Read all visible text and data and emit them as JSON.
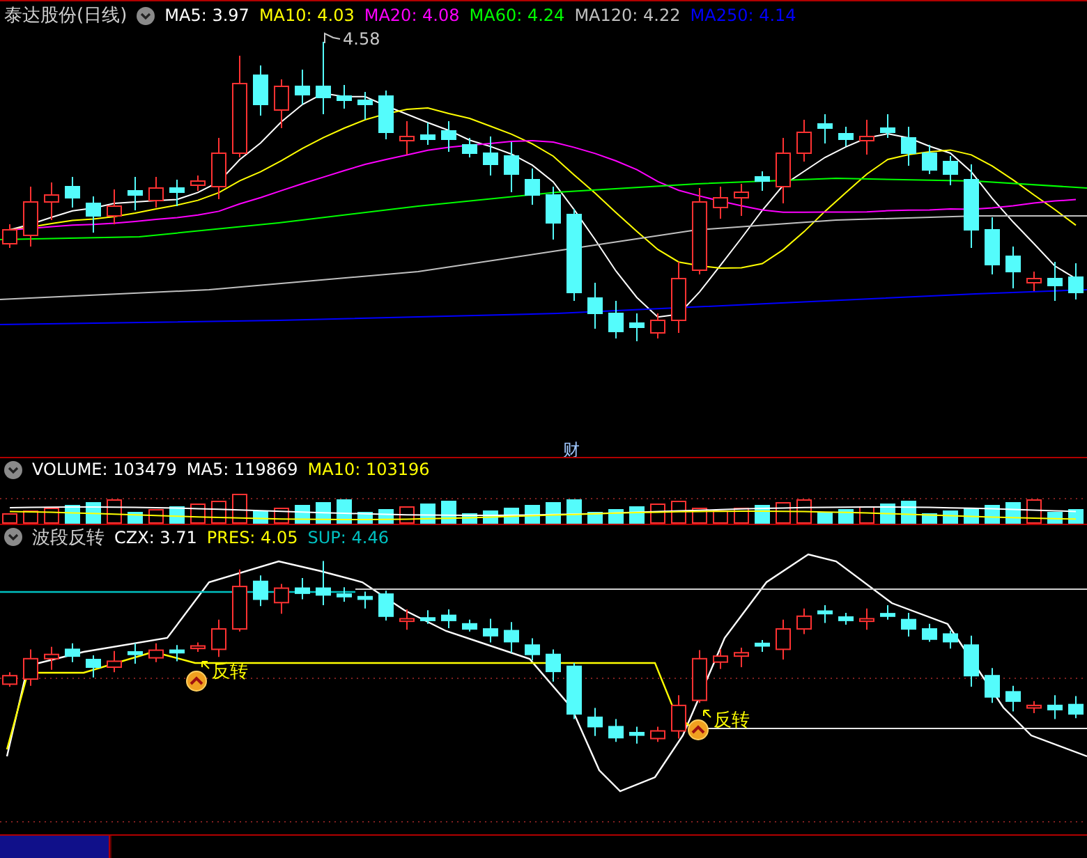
{
  "stock": {
    "name": "泰达股份(日线)"
  },
  "main_legend": [
    {
      "label": "MA5: 3.97",
      "color": "#ffffff"
    },
    {
      "label": "MA10: 4.03",
      "color": "#ffff00"
    },
    {
      "label": "MA20: 4.08",
      "color": "#ff00ff"
    },
    {
      "label": "MA60: 4.24",
      "color": "#00ff00"
    },
    {
      "label": "MA120: 4.22",
      "color": "#c0c0c0"
    },
    {
      "label": "MA250: 4.14",
      "color": "#0000ff"
    }
  ],
  "peak_label": "4.58",
  "event_marker": "财",
  "volume_legend": [
    {
      "label": "VOLUME: 103479",
      "color": "#ffffff"
    },
    {
      "label": "MA5: 119869",
      "color": "#ffffff"
    },
    {
      "label": "MA10: 103196",
      "color": "#ffff00"
    }
  ],
  "indicator": {
    "name": "波段反转",
    "legend": [
      {
        "label": "CZX: 3.71",
        "color": "#ffffff"
      },
      {
        "label": "PRES: 4.05",
        "color": "#ffff00"
      },
      {
        "label": "SUP: 4.46",
        "color": "#00c0c0"
      }
    ]
  },
  "signals": [
    {
      "label": "反转"
    },
    {
      "label": "反转"
    }
  ]
}
